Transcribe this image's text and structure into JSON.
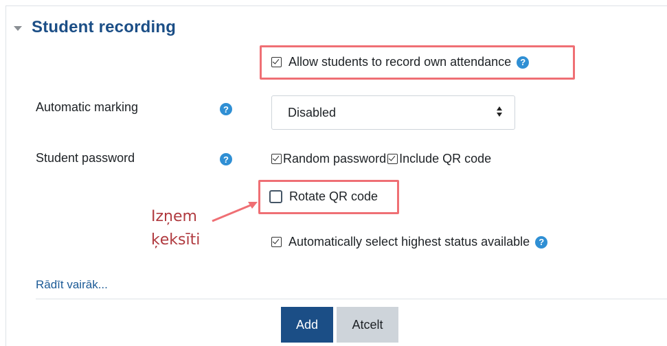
{
  "section": {
    "title": "Student recording"
  },
  "allow_self_record": {
    "label": "Allow students to record own attendance",
    "checked": true
  },
  "automatic_marking": {
    "label": "Automatic marking",
    "selected": "Disabled"
  },
  "student_password": {
    "label": "Student password",
    "random_password_label": "Random password",
    "random_password_checked": true,
    "include_qr_label": "Include QR code",
    "include_qr_checked": true
  },
  "rotate_qr": {
    "label": "Rotate QR code",
    "checked": false
  },
  "auto_highest": {
    "label": "Automatically select highest status available",
    "checked": true
  },
  "annotation": {
    "line1": "Izņem",
    "line2": "ķeksīti",
    "color": "#b03a3f"
  },
  "show_more": "Rādīt vairāk...",
  "buttons": {
    "add": "Add",
    "cancel": "Atcelt"
  },
  "colors": {
    "brand": "#1b4e86",
    "help": "#2f8fd4",
    "highlight": "#ef6f74"
  }
}
